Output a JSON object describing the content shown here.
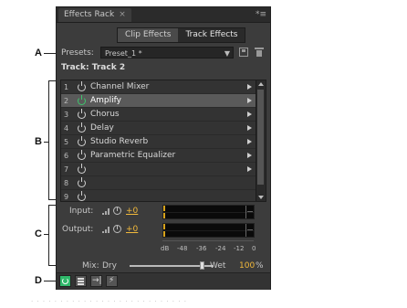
{
  "callouts": {
    "a": "A",
    "b": "B",
    "c": "C",
    "d": "D"
  },
  "panel": {
    "tab_title": "Effects Rack",
    "tab_close": "×",
    "menu_glyph": "*≡",
    "modes": {
      "clip": "Clip Effects",
      "track": "Track Effects"
    },
    "presets_label": "Presets:",
    "preset_value": "Preset_1 *",
    "track_label": "Track: Track 2"
  },
  "rack": {
    "rows": [
      {
        "num": "1",
        "name": "Channel Mixer",
        "on": false,
        "selected": false
      },
      {
        "num": "2",
        "name": "Amplify",
        "on": true,
        "selected": true
      },
      {
        "num": "3",
        "name": "Chorus",
        "on": false,
        "selected": false
      },
      {
        "num": "4",
        "name": "Delay",
        "on": false,
        "selected": false
      },
      {
        "num": "5",
        "name": "Studio Reverb",
        "on": false,
        "selected": false
      },
      {
        "num": "6",
        "name": "Parametric Equalizer",
        "on": false,
        "selected": false
      },
      {
        "num": "7",
        "name": "",
        "on": false,
        "selected": false
      },
      {
        "num": "8",
        "name": "",
        "on": false,
        "selected": false
      },
      {
        "num": "9",
        "name": "",
        "on": false,
        "selected": false
      }
    ]
  },
  "io": {
    "input_label": "Input:",
    "input_gain": "+0",
    "output_label": "Output:",
    "output_gain": "+0",
    "scale": [
      "dB",
      "-48",
      "-36",
      "-24",
      "-12",
      "0"
    ]
  },
  "mix": {
    "label": "Mix:",
    "dry": "Dry",
    "wet": "Wet",
    "value": "100",
    "unit": "%",
    "level": 1.0
  },
  "footer": {
    "buttons": [
      "power",
      "list",
      "insert",
      "bolt"
    ],
    "insert_glyph": "→|",
    "bolt_glyph": "⚡"
  },
  "colors": {
    "accent": "#f2b93b",
    "power_on": "#3ec46d",
    "footer_power": "#2fb86a"
  }
}
